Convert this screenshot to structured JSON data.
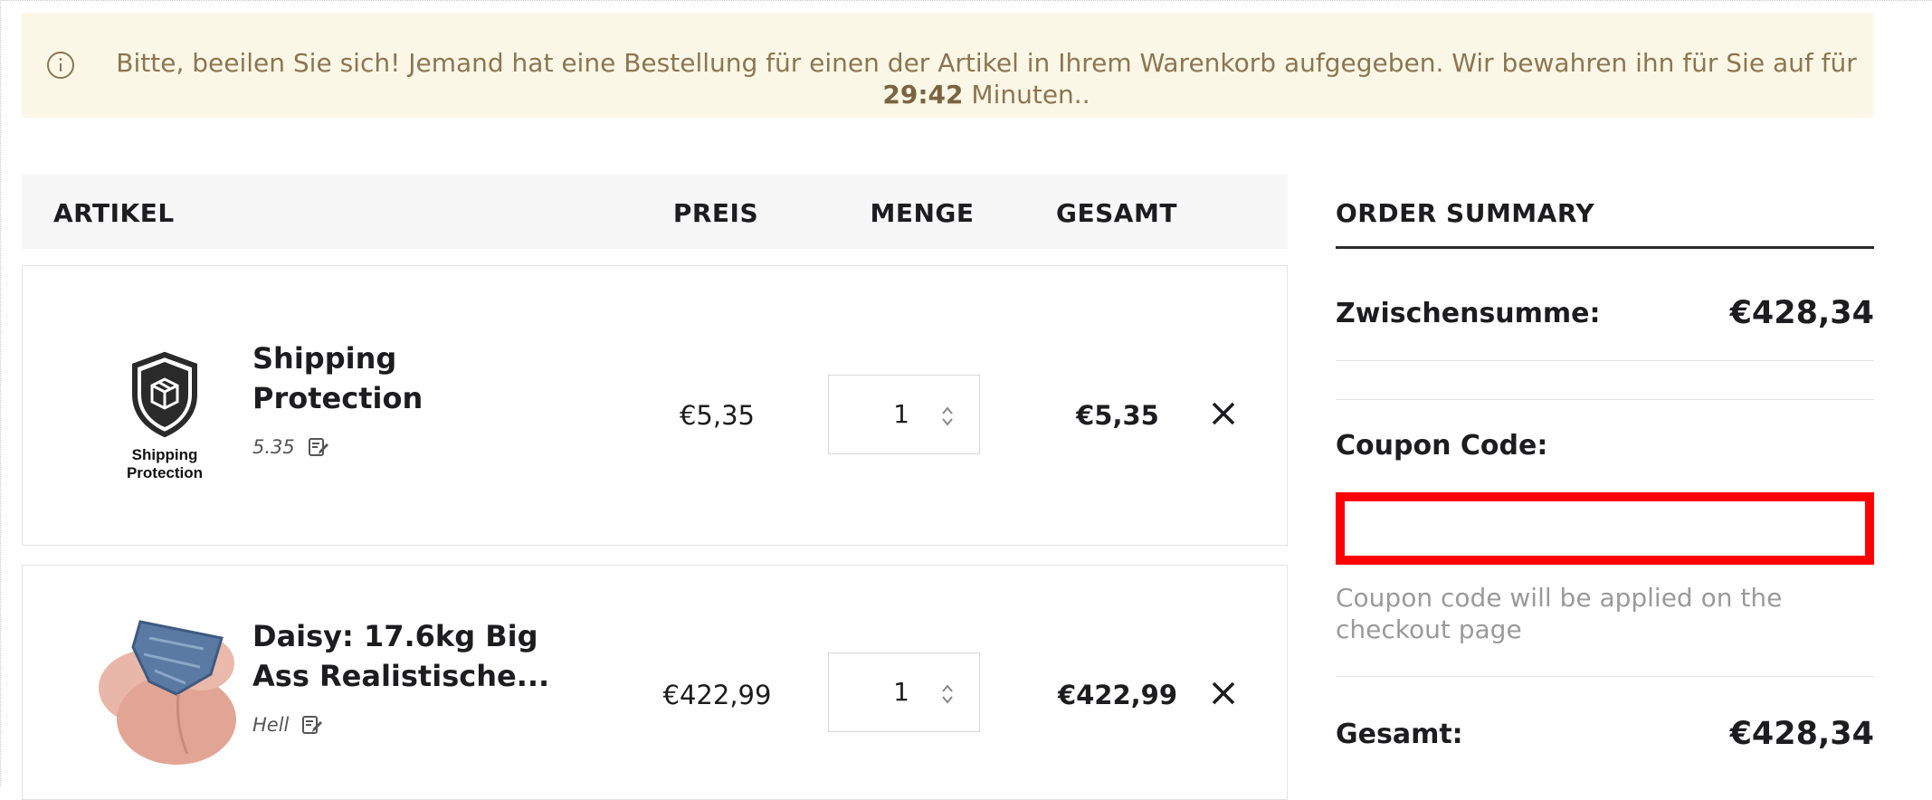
{
  "notice": {
    "text_before": "Bitte, beeilen Sie sich! Jemand hat eine Bestellung für einen der Artikel in Ihrem Warenkorb aufgegeben. Wir bewahren ihn für Sie auf für",
    "timer": "29:42",
    "text_after": "Minuten.."
  },
  "table": {
    "headers": {
      "artikel": "ARTIKEL",
      "preis": "PREIS",
      "menge": "MENGE",
      "gesamt": "GESAMT"
    },
    "rows": [
      {
        "name": "Shipping Protection",
        "variant": "5.35",
        "price": "€5,35",
        "quantity": "1",
        "total": "€5,35",
        "thumb_label_1": "Shipping",
        "thumb_label_2": "Protection"
      },
      {
        "name": "Daisy: 17.6kg Big Ass Realistische...",
        "variant": "Hell",
        "price": "€422,99",
        "quantity": "1",
        "total": "€422,99"
      }
    ]
  },
  "summary": {
    "title": "ORDER SUMMARY",
    "subtotal_label": "Zwischensumme:",
    "subtotal_value": "€428,34",
    "coupon_label": "Coupon Code:",
    "coupon_value": "",
    "coupon_note": "Coupon code will be applied on the checkout page",
    "total_label": "Gesamt:",
    "total_value": "€428,34"
  },
  "colors": {
    "notice_bg": "#fbf7e7",
    "notice_text": "#8d7550",
    "highlight": "#ff0000"
  }
}
